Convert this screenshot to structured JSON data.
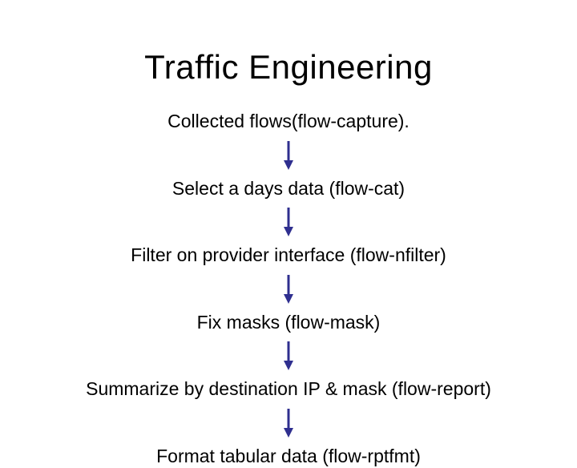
{
  "title": "Traffic Engineering",
  "steps": {
    "s0": "Collected flows(flow-capture).",
    "s1": "Select a days data (flow-cat)",
    "s2": "Filter on provider interface (flow-nfilter)",
    "s3": "Fix masks (flow-mask)",
    "s4": "Summarize by destination IP & mask (flow-report)",
    "s5": "Format tabular data (flow-rptfmt)"
  },
  "arrow_color": "#2f2f8f"
}
